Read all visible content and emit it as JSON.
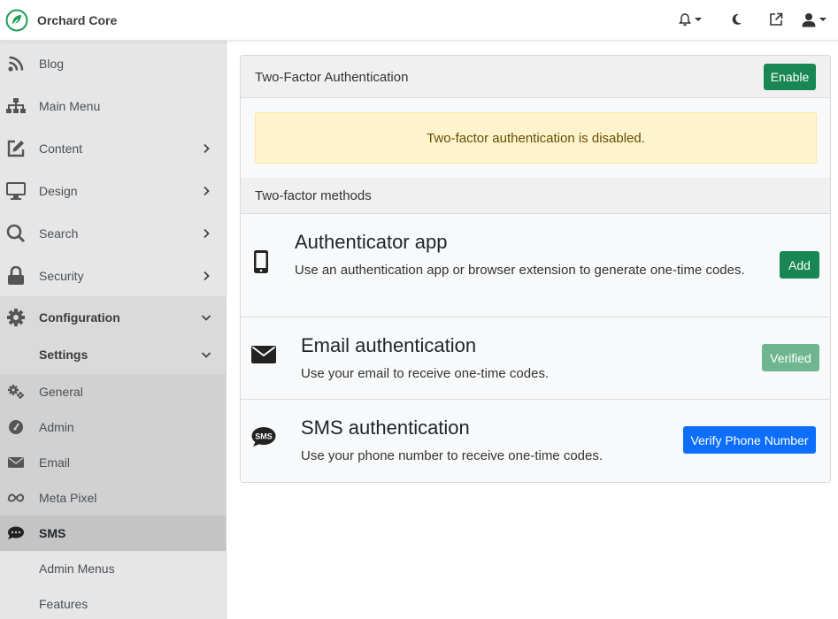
{
  "app": {
    "brand": "Orchard Core",
    "brand_color": "#1f9e54",
    "top_icons": [
      "bell-icon",
      "moon-icon",
      "external-link-icon",
      "user-icon"
    ]
  },
  "sidebar": {
    "items": [
      {
        "label": "Blog",
        "icon": "rss-icon"
      },
      {
        "label": "Main Menu",
        "icon": "sitemap-icon"
      },
      {
        "label": "Content",
        "icon": "edit-icon"
      },
      {
        "label": "Design",
        "icon": "monitor-icon"
      },
      {
        "label": "Search",
        "icon": "search-icon"
      },
      {
        "label": "Security",
        "icon": "lock-icon"
      },
      {
        "label": "Configuration",
        "icon": "gear-icon"
      }
    ],
    "settings_label": "Settings",
    "settings_items": [
      {
        "label": "General",
        "icon": "gears-icon"
      },
      {
        "label": "Admin",
        "icon": "gauge-icon"
      },
      {
        "label": "Email",
        "icon": "envelope-icon"
      },
      {
        "label": "Meta Pixel",
        "icon": "meta-icon"
      },
      {
        "label": "SMS",
        "icon": "sms-icon"
      }
    ],
    "other_items": [
      {
        "label": "Admin Menus"
      },
      {
        "label": "Features"
      }
    ]
  },
  "main": {
    "card_title": "Two-Factor Authentication",
    "enable_button": "Enable",
    "alert_text": "Two-factor authentication is disabled.",
    "methods_title": "Two-factor methods",
    "methods": [
      {
        "title": "Authenticator app",
        "description": "Use an authentication app or browser extension to generate one-time codes.",
        "button": "Add",
        "icon": "mobile-icon"
      },
      {
        "title": "Email authentication",
        "description": "Use your email to receive one-time codes.",
        "button": "Verified",
        "icon": "envelope-icon"
      },
      {
        "title": "SMS authentication",
        "description": "Use your phone number to receive one-time codes.",
        "button": "Verify Phone Number",
        "icon": "sms-icon"
      }
    ]
  },
  "colors": {
    "success": "#198754",
    "primary": "#0d6efd",
    "alert_bg": "#fff3cd",
    "alert_text": "#664d03"
  }
}
